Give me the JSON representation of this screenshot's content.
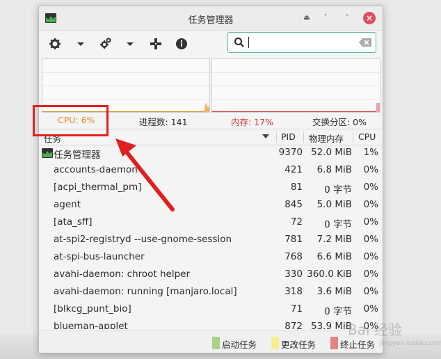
{
  "window": {
    "title": "任务管理器"
  },
  "search": {
    "value": "",
    "placeholder": ""
  },
  "stats": {
    "cpu": "CPU: 6%",
    "processes": "进程数: 141",
    "memory": "内存: 17%",
    "swap": "交换分区: 0%"
  },
  "columns": {
    "task": "任务",
    "pid": "PID",
    "mem": "物理内存",
    "cpu": "CPU"
  },
  "rows": [
    {
      "name": "任务管理器",
      "pid": "9370",
      "mem": "52.0 MiB",
      "cpu": "1%"
    },
    {
      "name": "accounts-daemon",
      "pid": "421",
      "mem": "6.8 MiB",
      "cpu": "0%"
    },
    {
      "name": "[acpi_thermal_pm]",
      "pid": "81",
      "mem": "0 字节",
      "cpu": "0%"
    },
    {
      "name": "agent",
      "pid": "845",
      "mem": "5.0 MiB",
      "cpu": "0%"
    },
    {
      "name": "[ata_sff]",
      "pid": "72",
      "mem": "0 字节",
      "cpu": "0%"
    },
    {
      "name": "at-spi2-registryd --use-gnome-session",
      "pid": "781",
      "mem": "7.2 MiB",
      "cpu": "0%"
    },
    {
      "name": "at-spi-bus-launcher",
      "pid": "768",
      "mem": "6.6 MiB",
      "cpu": "0%"
    },
    {
      "name": "avahi-daemon: chroot helper",
      "pid": "330",
      "mem": "360.0 KiB",
      "cpu": "0%"
    },
    {
      "name": "avahi-daemon: running [manjaro.local]",
      "pid": "318",
      "mem": "3.6 MiB",
      "cpu": "0%"
    },
    {
      "name": "[blkcg_punt_bio]",
      "pid": "71",
      "mem": "0 字节",
      "cpu": "0%"
    },
    {
      "name": "blueman-applet",
      "pid": "872",
      "mem": "53.9 MiB",
      "cpu": "0%"
    }
  ],
  "legend": {
    "start": "启动任务",
    "change": "更改任务",
    "end": "终止任务"
  },
  "colors": {
    "accent": "#5fb7a6",
    "cpu": "#e08a1e",
    "memory": "#d03a3a",
    "highlight": "#e21f1f",
    "legend_start": "#a8d48a",
    "legend_change": "#f7ee8a",
    "legend_end": "#e58282"
  },
  "watermark": {
    "text": "Bai 经验",
    "sub": "jingyan.baidu.com"
  }
}
